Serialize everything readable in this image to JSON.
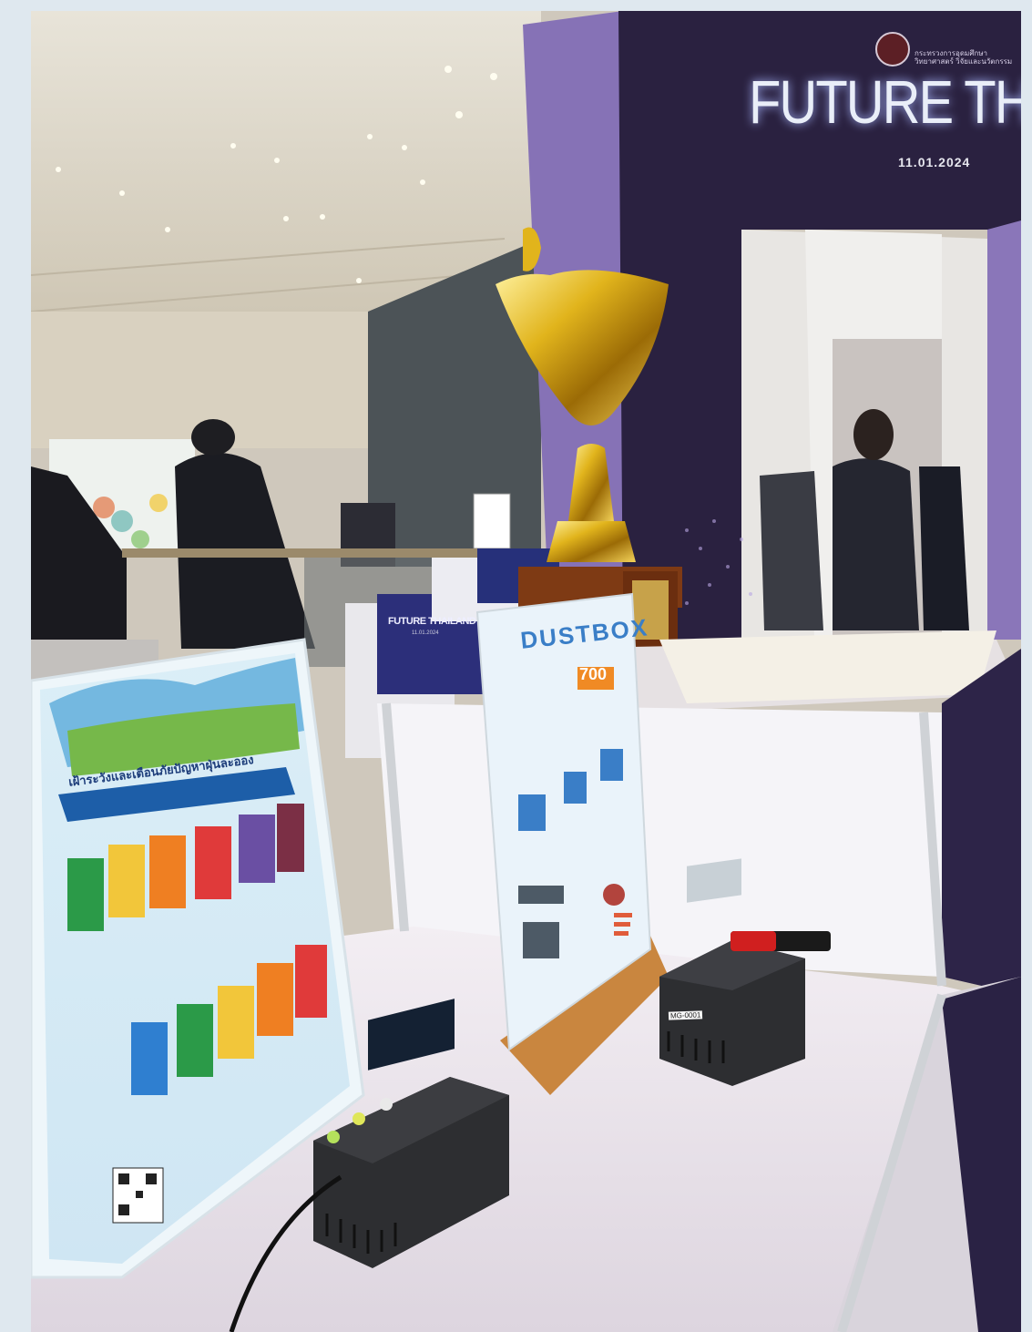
{
  "scene": {
    "backdrop": {
      "title": "FUTURE THAIL",
      "date": "11.01.2024",
      "logo_text": "กระทรวงการอุดมศึกษา วิทยาศาสตร์ วิจัยและนวัตกรรม"
    },
    "display_box": {
      "title": "FUTURE THAILAND",
      "date": "11.01.2024"
    },
    "poster_left": {
      "headline": "เฝ้าระวังและเตือนภัยปัญหาฝุ่นละออง"
    },
    "poster_center": {
      "headline": "DUSTBOX",
      "number": "700"
    },
    "device": {
      "label": "MG-0001"
    },
    "colors": {
      "backdrop_purple": "#2a2140",
      "pillar_violet": "#8672b6",
      "trophy_gold": "#d9a514",
      "table_white": "#ece7ee"
    }
  }
}
